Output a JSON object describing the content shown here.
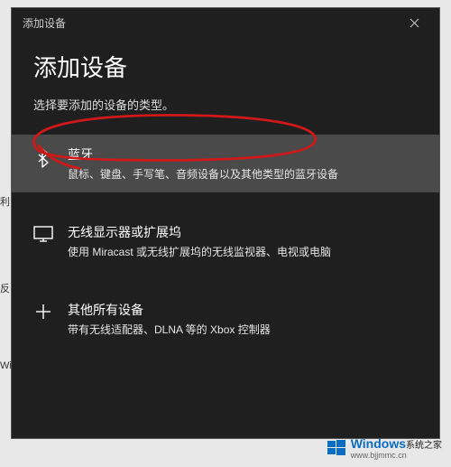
{
  "titlebar": {
    "title": "添加设备"
  },
  "dialog": {
    "heading": "添加设备",
    "subheading": "选择要添加的设备的类型。"
  },
  "options": {
    "bluetooth": {
      "title": "蓝牙",
      "desc": "鼠标、键盘、手写笔、音频设备以及其他类型的蓝牙设备"
    },
    "wireless": {
      "title": "无线显示器或扩展坞",
      "desc": "使用 Miracast 或无线扩展坞的无线监视器、电视或电脑"
    },
    "other": {
      "title": "其他所有设备",
      "desc": "带有无线适配器、DLNA 等的 Xbox 控制器"
    }
  },
  "watermark": {
    "main": "Windows",
    "sub": "系统之家",
    "url": "www.bjjmmc.cn"
  },
  "fragments": {
    "f1": "利",
    "f2": "反",
    "f3": "Wi"
  }
}
